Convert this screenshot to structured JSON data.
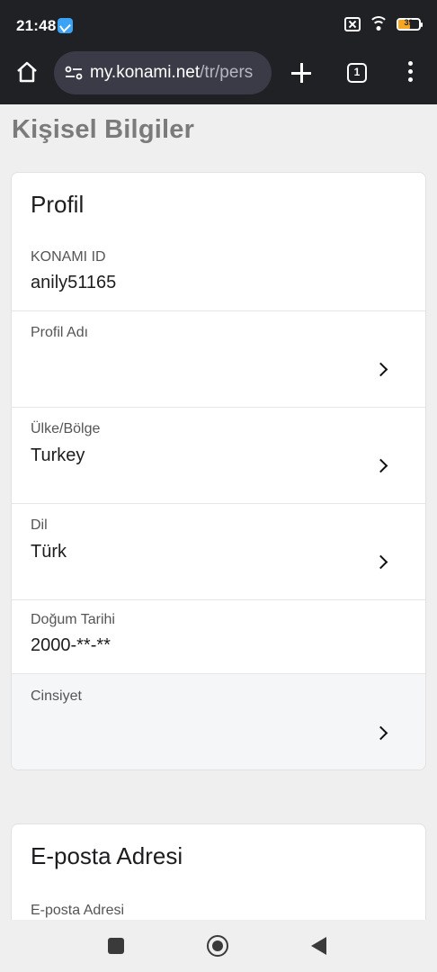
{
  "status_bar": {
    "time": "21:48",
    "battery": "39",
    "icons": [
      "telegram-icon",
      "sim-off-icon",
      "wifi-icon",
      "battery-icon"
    ]
  },
  "browser": {
    "url_host": "my.konami.net",
    "url_path": "/tr/pers",
    "tab_count": "1",
    "icons": [
      "home-icon",
      "site-settings-icon",
      "new-tab-icon",
      "tabs-icon",
      "menu-icon"
    ]
  },
  "page": {
    "title": "Kişisel Bilgiler"
  },
  "profile": {
    "title": "Profil",
    "konami_id_label": "KONAMI ID",
    "konami_id_value": "anily51165",
    "profile_name_label": "Profil Adı",
    "profile_name_value": "",
    "country_label": "Ülke/Bölge",
    "country_value": "Turkey",
    "language_label": "Dil",
    "language_value": "Türk",
    "birthdate_label": "Doğum Tarihi",
    "birthdate_value": "2000-**-**",
    "gender_label": "Cinsiyet",
    "gender_value": ""
  },
  "email": {
    "title": "E-posta Adresi",
    "field_label": "E-posta Adresi"
  },
  "colors": {
    "toolbar_bg": "#1f2125",
    "urlbar_bg": "#3a3b46",
    "page_bg": "#efefef",
    "card_bg": "#ffffff",
    "shaded_row_bg": "#f5f6f8"
  }
}
